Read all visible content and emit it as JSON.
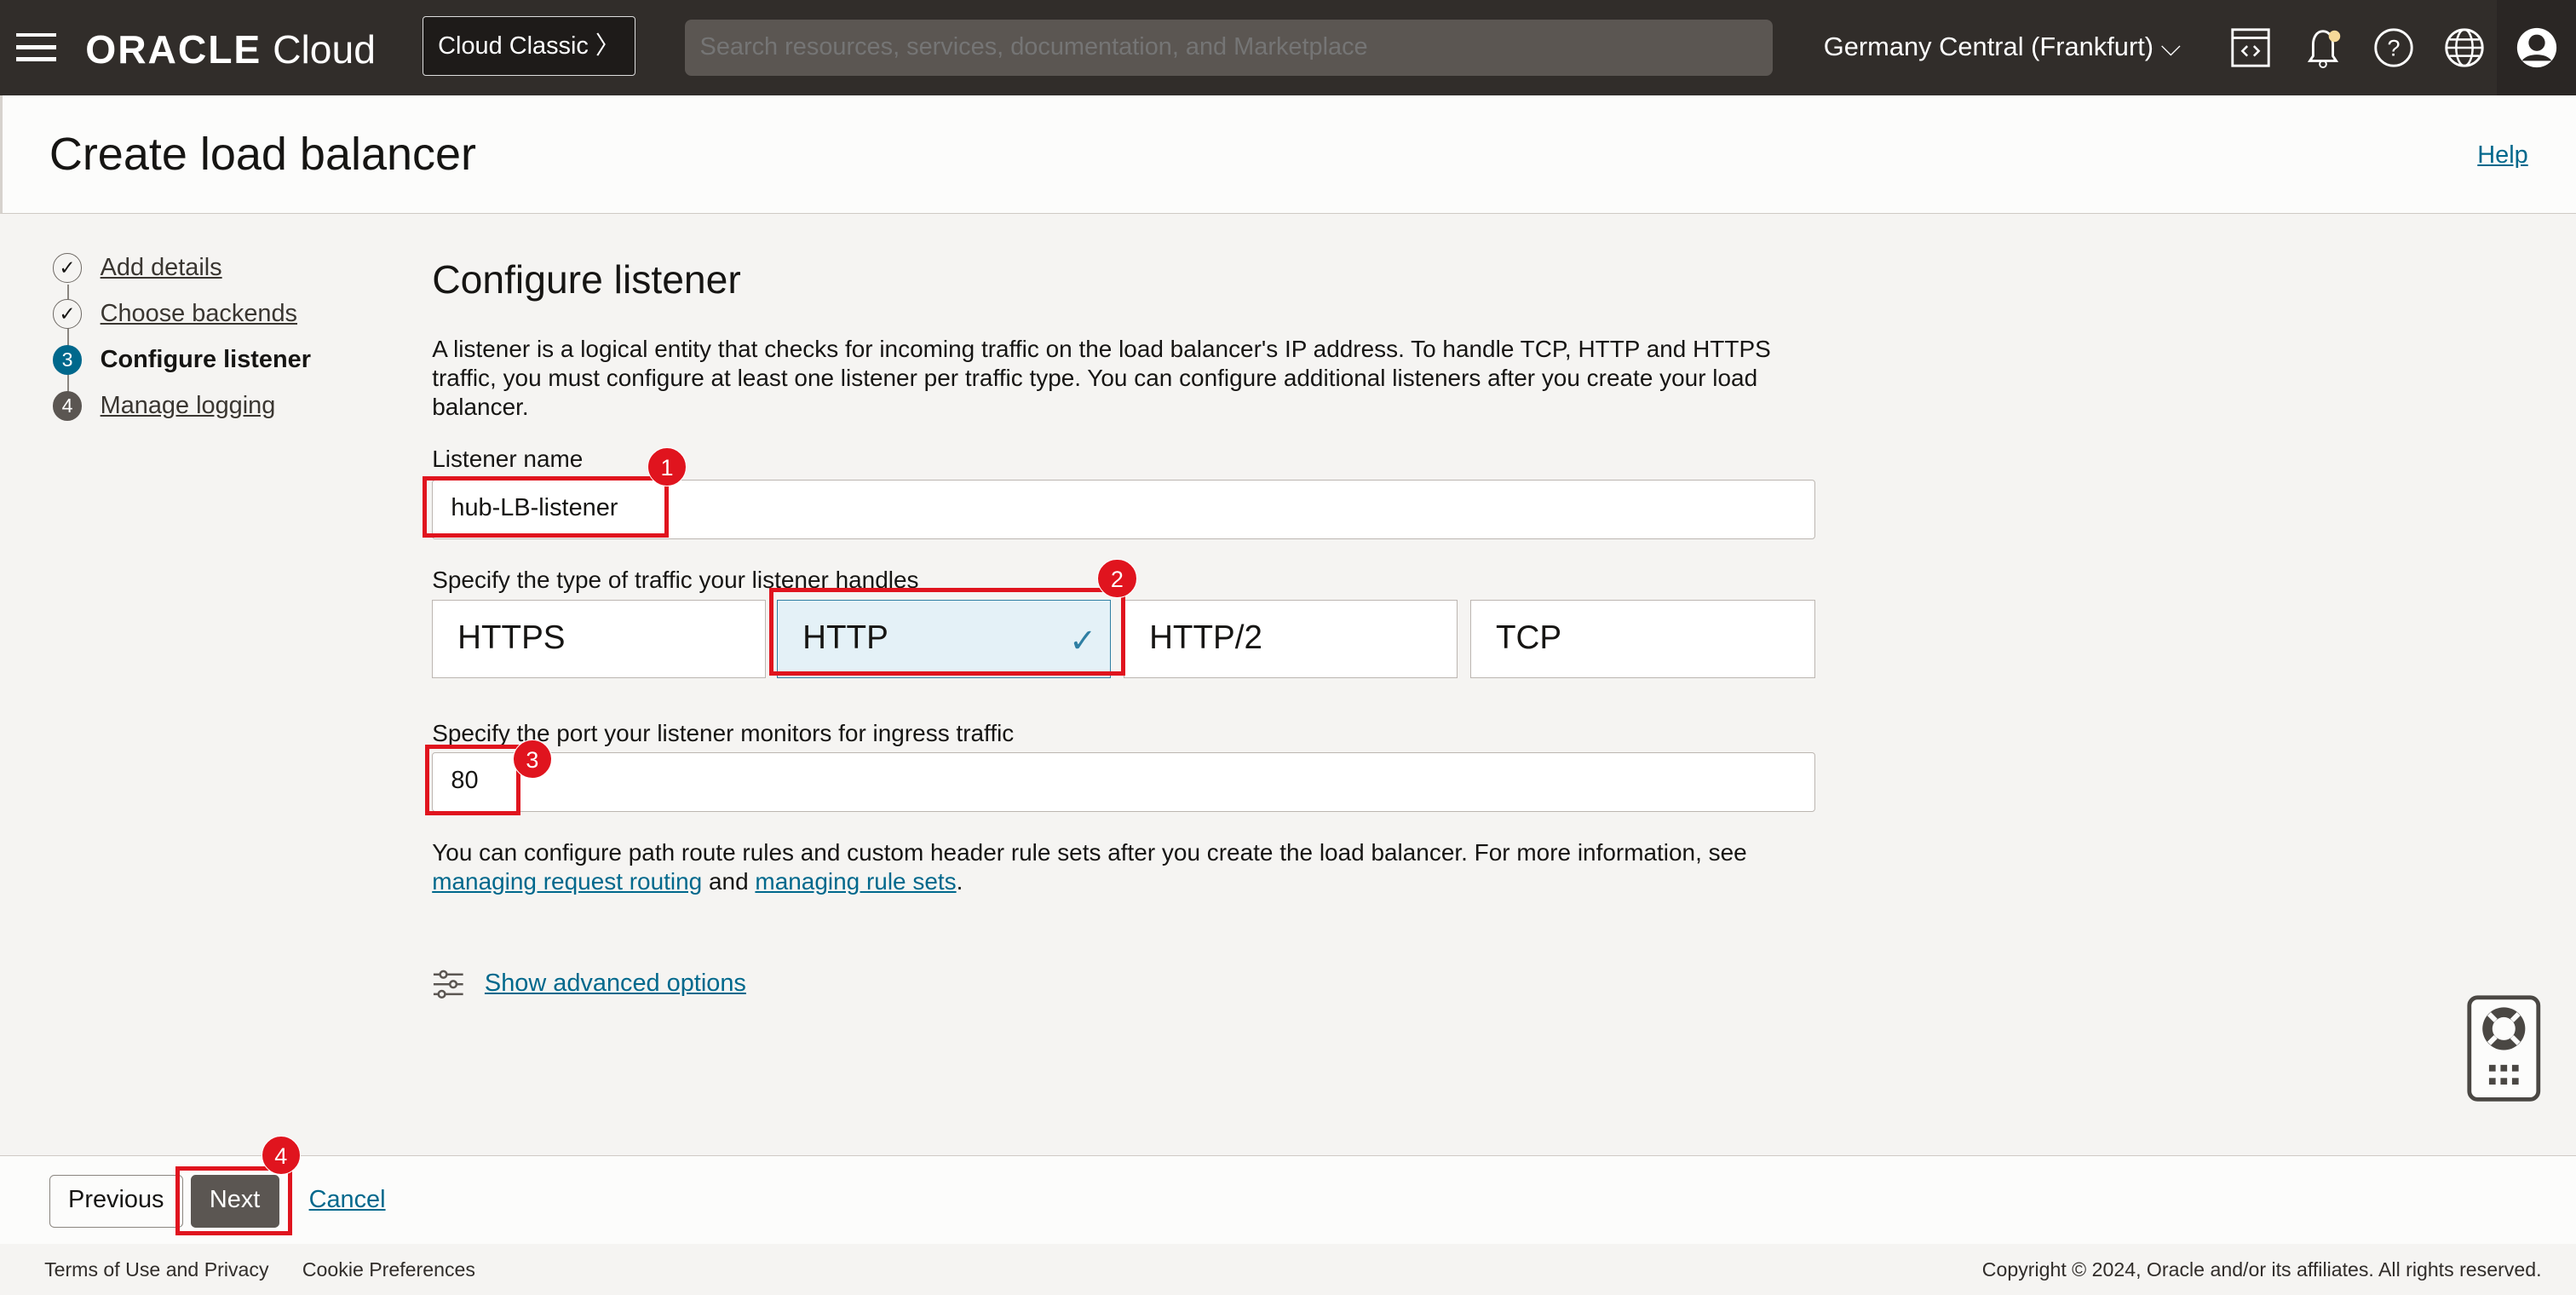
{
  "header": {
    "logo_brand": "ORACLE",
    "logo_product": "Cloud",
    "cloud_classic": "Cloud Classic",
    "search_placeholder": "Search resources, services, documentation, and Marketplace",
    "region": "Germany Central (Frankfurt)",
    "notification_dot_color": "#f5d998"
  },
  "page": {
    "title": "Create load balancer",
    "help": "Help"
  },
  "steps": [
    {
      "num": "1",
      "label": "Add details",
      "state": "done"
    },
    {
      "num": "2",
      "label": "Choose backends",
      "state": "done"
    },
    {
      "num": "3",
      "label": "Configure listener",
      "state": "current"
    },
    {
      "num": "4",
      "label": "Manage logging",
      "state": "todo"
    }
  ],
  "form": {
    "heading": "Configure listener",
    "description": "A listener is a logical entity that checks for incoming traffic on the load balancer's IP address. To handle TCP, HTTP and HTTPS traffic, you must configure at least one listener per traffic type. You can configure additional listeners after you create your load balancer.",
    "listener_name_label": "Listener name",
    "listener_name_value": "hub-LB-listener",
    "traffic_label": "Specify the type of traffic your listener handles",
    "traffic_options": [
      "HTTPS",
      "HTTP",
      "HTTP/2",
      "TCP"
    ],
    "traffic_selected": "HTTP",
    "port_label": "Specify the port your listener monitors for ingress traffic",
    "port_value": "80",
    "routing_note_pre": "You can configure path route rules and custom header rule sets after you create the load balancer. For more information, see",
    "routing_link1": "managing request routing",
    "routing_and": "and",
    "routing_link2": "managing rule sets",
    "routing_end": ".",
    "advanced": "Show advanced options"
  },
  "annotations": [
    "1",
    "2",
    "3",
    "4"
  ],
  "actions": {
    "previous": "Previous",
    "next": "Next",
    "cancel": "Cancel"
  },
  "footer": {
    "terms": "Terms of Use and Privacy",
    "cookies": "Cookie Preferences",
    "copyright": "Copyright © 2024, Oracle and/or its affiliates. All rights reserved."
  }
}
